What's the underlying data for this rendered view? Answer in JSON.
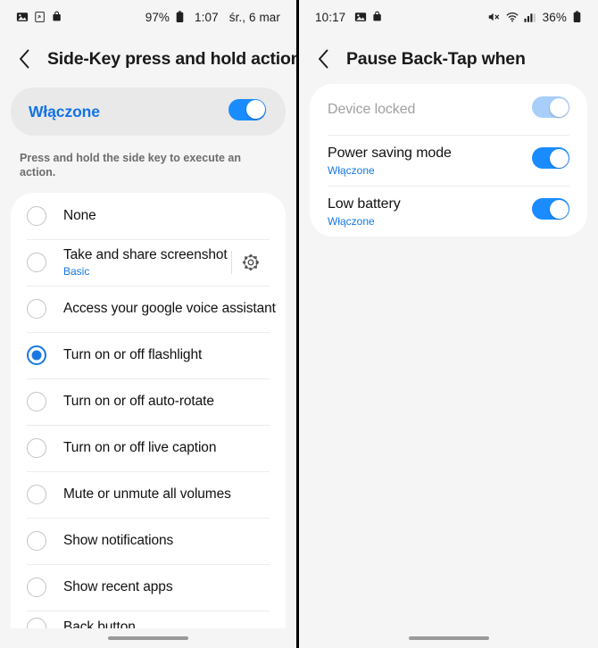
{
  "left_panel": {
    "status_bar": {
      "icons_left": [
        "image-icon",
        "screenshot-icon",
        "bag-icon"
      ],
      "battery_percent": "97%",
      "time": "1:07",
      "date": "śr., 6 mar"
    },
    "header": {
      "back": "‹",
      "title": "Side-Key press and hold action"
    },
    "master_toggle": {
      "label": "Włączone",
      "state": "on"
    },
    "hint": "Press and hold the side key to execute an action.",
    "options": [
      {
        "label": "None",
        "selected": false,
        "sub": null,
        "gear": false
      },
      {
        "label": "Take and share screenshot",
        "selected": false,
        "sub": "Basic",
        "gear": true
      },
      {
        "label": "Access your google voice assistant",
        "selected": false,
        "sub": null,
        "gear": false
      },
      {
        "label": "Turn on or off flashlight",
        "selected": true,
        "sub": null,
        "gear": false
      },
      {
        "label": "Turn on or off auto-rotate",
        "selected": false,
        "sub": null,
        "gear": false
      },
      {
        "label": "Turn on or off live caption",
        "selected": false,
        "sub": null,
        "gear": false
      },
      {
        "label": "Mute or unmute all volumes",
        "selected": false,
        "sub": null,
        "gear": false
      },
      {
        "label": "Show notifications",
        "selected": false,
        "sub": null,
        "gear": false
      },
      {
        "label": "Show recent apps",
        "selected": false,
        "sub": null,
        "gear": false
      },
      {
        "label": "Back button",
        "selected": false,
        "sub": null,
        "gear": false
      }
    ]
  },
  "right_panel": {
    "status_bar": {
      "time": "10:17",
      "icons_left": [
        "image-icon",
        "bag-icon"
      ],
      "icons_right": [
        "mute-icon",
        "wifi-icon",
        "signal-icon"
      ],
      "battery_percent": "36%"
    },
    "header": {
      "back": "‹",
      "title": "Pause Back-Tap when"
    },
    "settings": [
      {
        "label": "Device locked",
        "sub": null,
        "state": "on",
        "disabled": true
      },
      {
        "label": "Power saving mode",
        "sub": "Włączone",
        "state": "on",
        "disabled": false
      },
      {
        "label": "Low battery",
        "sub": "Włączone",
        "state": "on",
        "disabled": false
      }
    ]
  },
  "colors": {
    "accent_blue": "#1578e3",
    "toggle_on": "#1a8cff",
    "toggle_disabled": "#a8cffa",
    "panel_bg": "#f5f5f5",
    "card_bg": "#ffffff",
    "toggle_card_bg": "#e9e9e9"
  }
}
